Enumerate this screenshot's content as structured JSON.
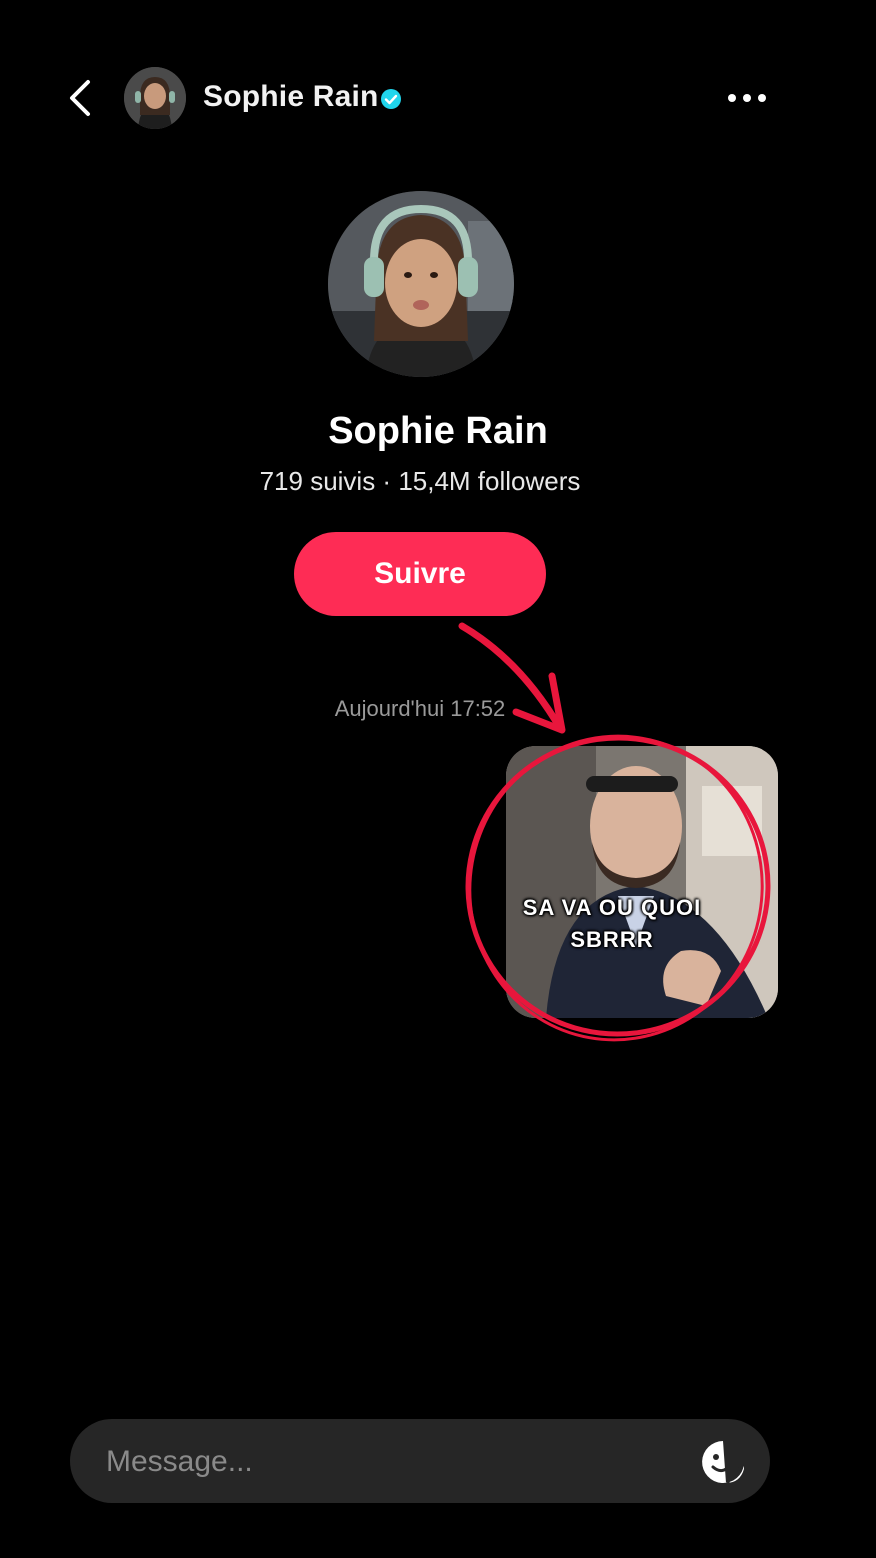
{
  "header": {
    "username": "Sophie Rain",
    "verified": true
  },
  "profile": {
    "display_name": "Sophie Rain",
    "stats": "719 suivis · 15,4M followers",
    "follow_label": "Suivre"
  },
  "conversation": {
    "timestamp": "Aujourd'hui 17:52",
    "sticker_caption_line1": "SA VA OU QUOI",
    "sticker_caption_line2": "SBRRR"
  },
  "composer": {
    "placeholder": "Message..."
  },
  "colors": {
    "background": "#000000",
    "follow_button": "#fe2c55",
    "verified_badge": "#20d5ec",
    "annotation": "#e8163c",
    "composer_bg": "#262626"
  },
  "icons": {
    "back": "chevron-left-icon",
    "verified": "verified-badge-icon",
    "more": "more-horizontal-icon",
    "sticker": "sticker-emoji-icon"
  }
}
